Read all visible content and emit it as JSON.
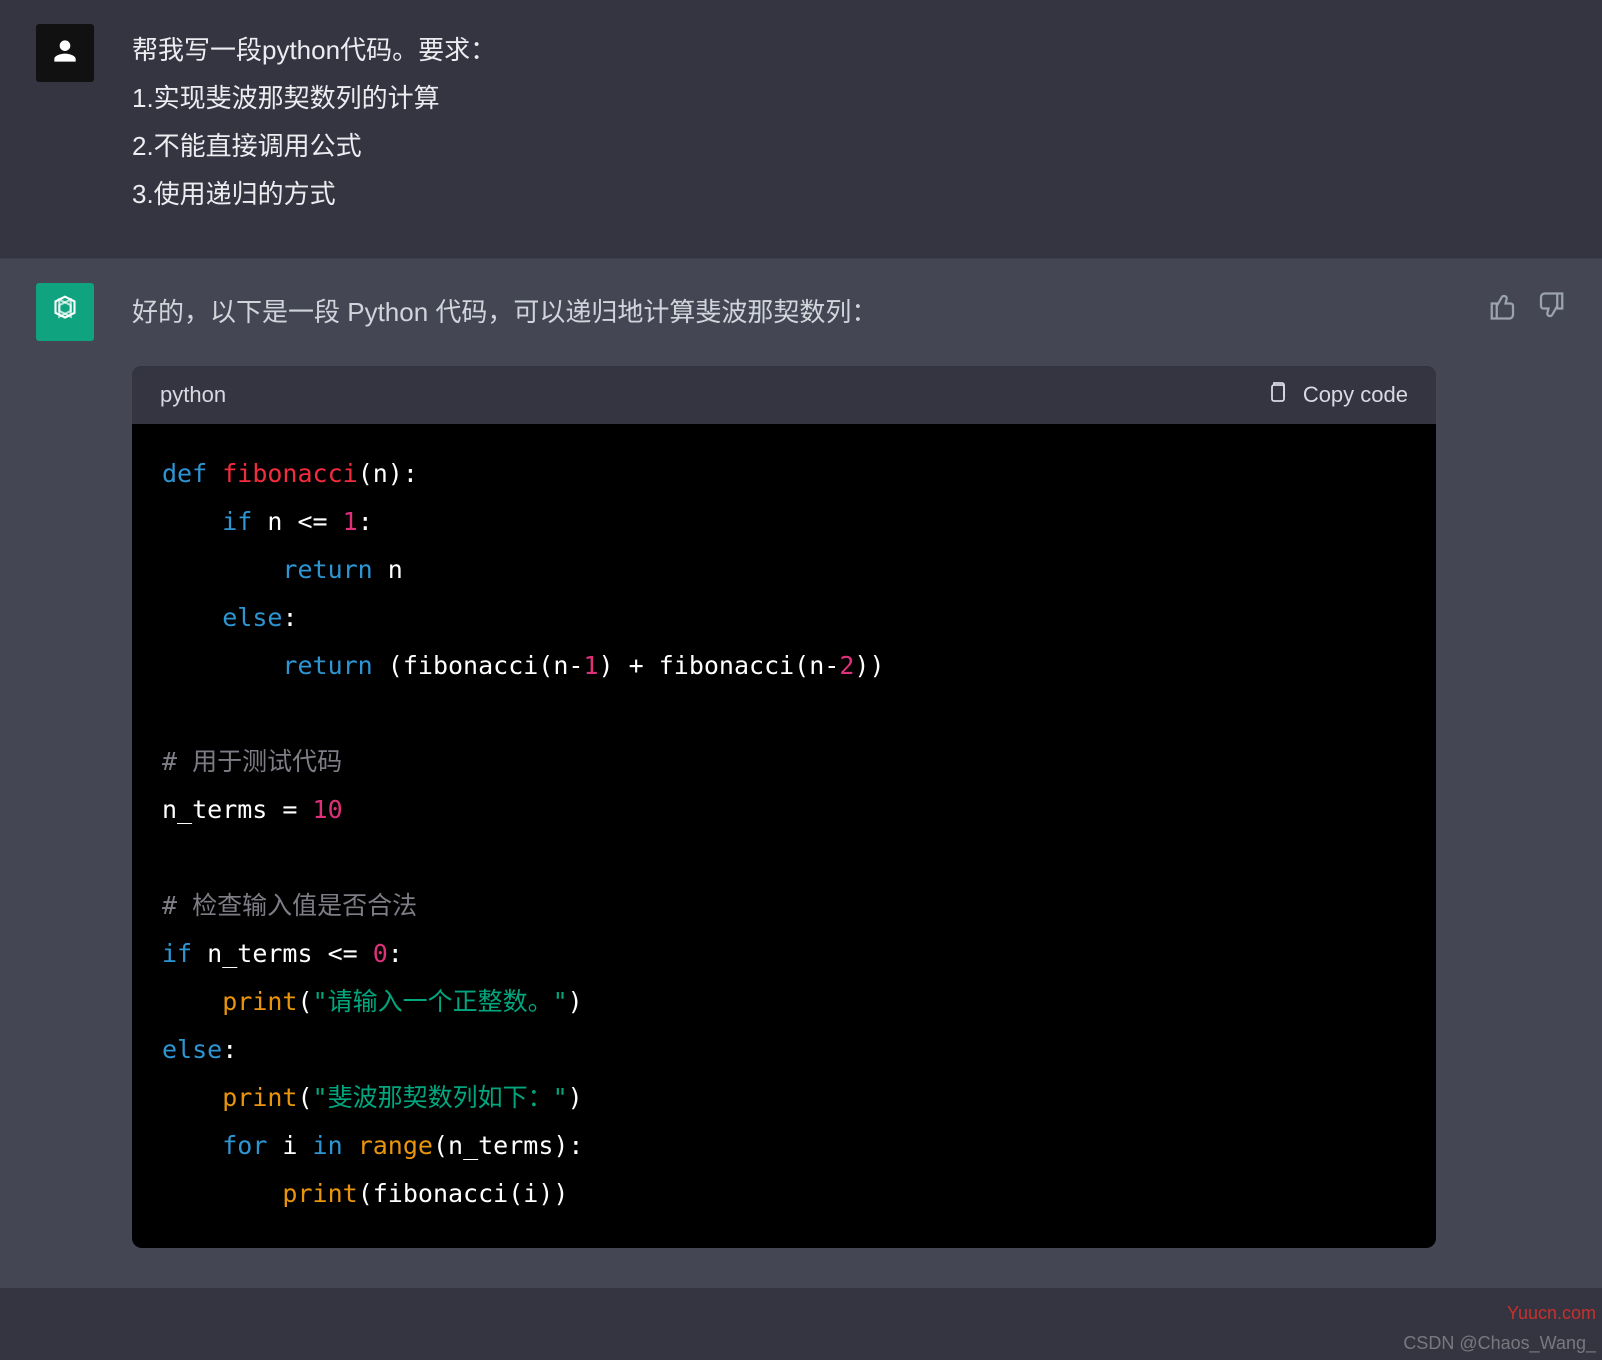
{
  "user": {
    "prompt_lines": [
      "帮我写一段python代码。要求：",
      "1.实现斐波那契数列的计算",
      "2.不能直接调用公式",
      "3.使用递归的方式"
    ]
  },
  "assistant": {
    "intro": "好的，以下是一段 Python 代码，可以递归地计算斐波那契数列：",
    "code_lang": "python",
    "copy_label": "Copy code",
    "code_tokens": [
      [
        [
          "def ",
          "kw"
        ],
        [
          "fibonacci",
          "fn"
        ],
        [
          "(n):",
          "txt"
        ]
      ],
      [
        [
          "    ",
          "txt"
        ],
        [
          "if",
          "kw"
        ],
        [
          " n <= ",
          "txt"
        ],
        [
          "1",
          "num"
        ],
        [
          ":",
          "txt"
        ]
      ],
      [
        [
          "        ",
          "txt"
        ],
        [
          "return",
          "kw"
        ],
        [
          " n",
          "txt"
        ]
      ],
      [
        [
          "    ",
          "txt"
        ],
        [
          "else",
          "kw"
        ],
        [
          ":",
          "txt"
        ]
      ],
      [
        [
          "        ",
          "txt"
        ],
        [
          "return",
          "kw"
        ],
        [
          " (fibonacci(n-",
          "txt"
        ],
        [
          "1",
          "num"
        ],
        [
          ") + fibonacci(n-",
          "txt"
        ],
        [
          "2",
          "num"
        ],
        [
          "))",
          "txt"
        ]
      ],
      [],
      [
        [
          "# 用于测试代码",
          "cm"
        ]
      ],
      [
        [
          "n_terms = ",
          "txt"
        ],
        [
          "10",
          "num"
        ]
      ],
      [],
      [
        [
          "# 检查输入值是否合法",
          "cm"
        ]
      ],
      [
        [
          "if",
          "kw"
        ],
        [
          " n_terms <= ",
          "txt"
        ],
        [
          "0",
          "num"
        ],
        [
          ":",
          "txt"
        ]
      ],
      [
        [
          "    ",
          "txt"
        ],
        [
          "print",
          "bi"
        ],
        [
          "(",
          "txt"
        ],
        [
          "\"请输入一个正整数。\"",
          "str"
        ],
        [
          ")",
          "txt"
        ]
      ],
      [
        [
          "else",
          "kw"
        ],
        [
          ":",
          "txt"
        ]
      ],
      [
        [
          "    ",
          "txt"
        ],
        [
          "print",
          "bi"
        ],
        [
          "(",
          "txt"
        ],
        [
          "\"斐波那契数列如下：\"",
          "str"
        ],
        [
          ")",
          "txt"
        ]
      ],
      [
        [
          "    ",
          "txt"
        ],
        [
          "for",
          "kw"
        ],
        [
          " i ",
          "txt"
        ],
        [
          "in",
          "kw"
        ],
        [
          " ",
          "txt"
        ],
        [
          "range",
          "bi"
        ],
        [
          "(n_terms):",
          "txt"
        ]
      ],
      [
        [
          "        ",
          "txt"
        ],
        [
          "print",
          "bi"
        ],
        [
          "(fibonacci(i))",
          "txt"
        ]
      ]
    ]
  },
  "watermarks": {
    "right": "Yuucn.com",
    "csdn": "CSDN @Chaos_Wang_"
  }
}
